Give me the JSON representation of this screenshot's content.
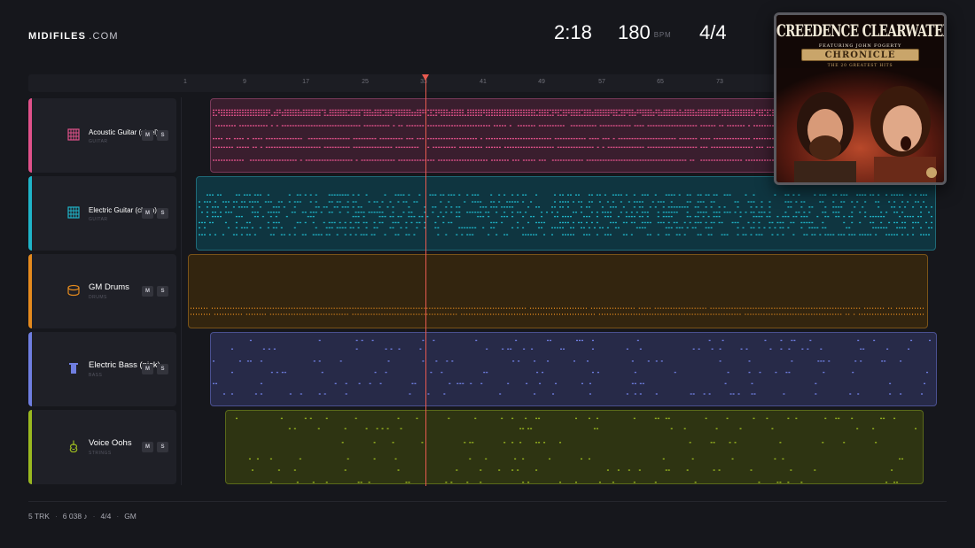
{
  "app": {
    "brand": "MIDIFILES",
    "tld": ".COM"
  },
  "transport": {
    "time": "2:18",
    "bpm": "180",
    "bpm_unit": "BPM",
    "signature": "4/4"
  },
  "ruler": {
    "ticks": [
      "1",
      "9",
      "17",
      "25",
      "33",
      "41",
      "49",
      "57",
      "65",
      "73"
    ]
  },
  "tracks": [
    {
      "name": "Acoustic Guitar (steel)",
      "category": "GUITAR",
      "color": "#e0518a",
      "icon": "guitar-fretboard-icon",
      "mute_label": "M",
      "solo_label": "S"
    },
    {
      "name": "Electric Guitar (clean)",
      "category": "GUITAR",
      "color": "#1fb4c8",
      "icon": "guitar-fretboard-icon",
      "mute_label": "M",
      "solo_label": "S"
    },
    {
      "name": "GM Drums",
      "category": "DRUMS",
      "color": "#e48a1e",
      "icon": "drum-icon",
      "mute_label": "M",
      "solo_label": "S"
    },
    {
      "name": "Electric Bass (pick)",
      "category": "BASS",
      "color": "#6f7ee0",
      "icon": "bass-icon",
      "mute_label": "M",
      "solo_label": "S"
    },
    {
      "name": "Voice Oohs",
      "category": "STRINGS",
      "color": "#9ab820",
      "icon": "violin-icon",
      "mute_label": "M",
      "solo_label": "S"
    }
  ],
  "album": {
    "title": "CREEDENCE CLEARWATER REVIVAL",
    "featuring": "FEATURING JOHN FOGERTY",
    "banner": "CHRONICLE",
    "subtitle": "THE 20 GREATEST HITS"
  },
  "footer": {
    "tracks": "5 TRK",
    "notes": "6 038 ♪",
    "signature": "4/4",
    "standard": "GM"
  }
}
